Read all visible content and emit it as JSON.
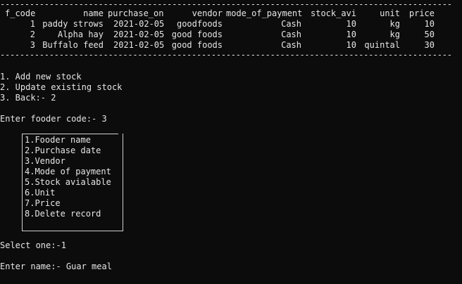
{
  "separator": "--------------------------------------------------------------------------------------------",
  "table": {
    "headers": [
      "f_code",
      "name",
      "purchase_on",
      "vendor",
      "mode_of_payment",
      "stock_avi",
      "unit",
      "price"
    ],
    "rows": [
      [
        "1",
        "paddy strows",
        "2021-02-05",
        "goodfoods",
        "Cash",
        "10",
        "kg",
        "10"
      ],
      [
        "2",
        "Alpha hay",
        "2021-02-05",
        "good foods",
        "Cash",
        "10",
        "kg",
        "50"
      ],
      [
        "3",
        "Buffalo feed",
        "2021-02-05",
        "good foods",
        "Cash",
        "10",
        "quintal",
        "30"
      ]
    ]
  },
  "main_menu": {
    "option_1": "1. Add new stock",
    "option_2": "2. Update existing stock",
    "option_3": "3. Back:- 2"
  },
  "prompt_code": "Enter fooder code:- 3",
  "edit_menu": {
    "items": [
      "1.Fooder name",
      "2.Purchase date",
      "3.Vendor",
      "4.Mode of payment",
      "5.Stock avialable",
      "6.Unit",
      "7.Price",
      "8.Delete record"
    ]
  },
  "prompt_select": "Select one:-1",
  "prompt_name": "Enter name:- Guar meal"
}
